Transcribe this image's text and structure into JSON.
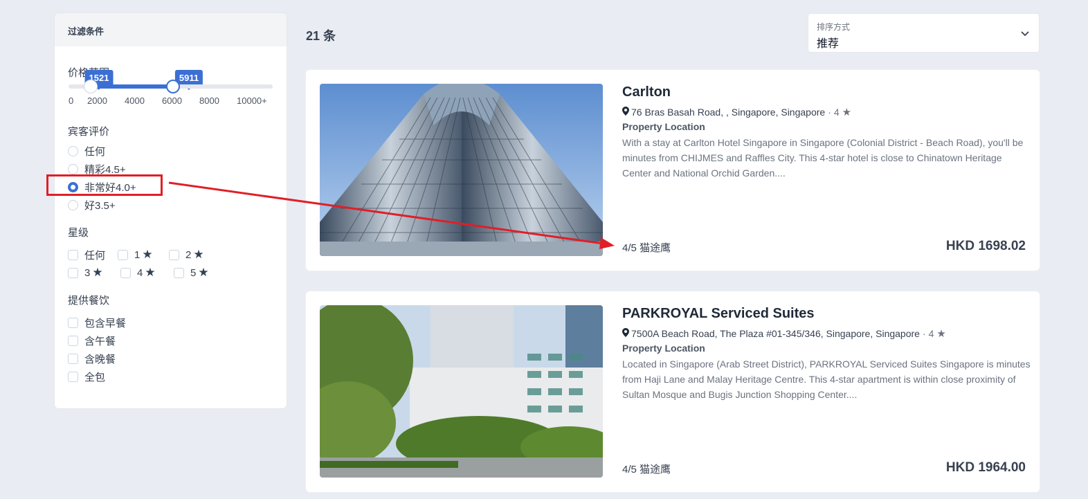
{
  "sidebar": {
    "header": "过滤条件",
    "price": {
      "title": "价格范围",
      "min": 1521,
      "max": 5911,
      "min_label": "1521",
      "max_label": "5911",
      "ticks": [
        "0",
        "2000",
        "4000",
        "6000",
        "8000",
        "10000+"
      ]
    },
    "guest_rating": {
      "title": "宾客评价",
      "options": [
        "任何",
        "精彩4.5+",
        "非常好4.0+",
        "好3.5+"
      ],
      "selected_index": 2
    },
    "star_rating": {
      "title": "星级",
      "options": [
        "任何",
        "1",
        "2",
        "3",
        "4",
        "5"
      ]
    },
    "meals": {
      "title": "提供餐饮",
      "options": [
        "包含早餐",
        "含午餐",
        "含晚餐",
        "全包"
      ]
    }
  },
  "results": {
    "count_label": "21 条",
    "sort_label": "排序方式",
    "sort_value": "推荐"
  },
  "hotels": [
    {
      "name": "Carlton",
      "address": "76 Bras Basah Road, , Singapore, Singapore",
      "stars": "4",
      "location_label": "Property Location",
      "description": "With a stay at Carlton Hotel Singapore in Singapore (Colonial District - Beach Road), you'll be minutes from CHIJMES and Raffles City. This 4-star hotel is close to Chinatown Heritage Center and National Orchid Garden....",
      "rating": "4/5 猫途鹰",
      "price": "HKD 1698.02"
    },
    {
      "name": "PARKROYAL Serviced Suites",
      "address": "7500A Beach Road, The Plaza #01-345/346, Singapore, Singapore",
      "stars": "4",
      "location_label": "Property Location",
      "description": "Located in Singapore (Arab Street District), PARKROYAL Serviced Suites Singapore is minutes from Haji Lane and Malay Heritage Centre. This 4-star apartment is within close proximity of Sultan Mosque and Bugis Junction Shopping Center....",
      "rating": "4/5 猫途鹰",
      "price": "HKD 1964.00"
    }
  ],
  "colors": {
    "accent": "#3b6fd4",
    "annotation": "#e01f26",
    "background": "#e9edf3"
  }
}
